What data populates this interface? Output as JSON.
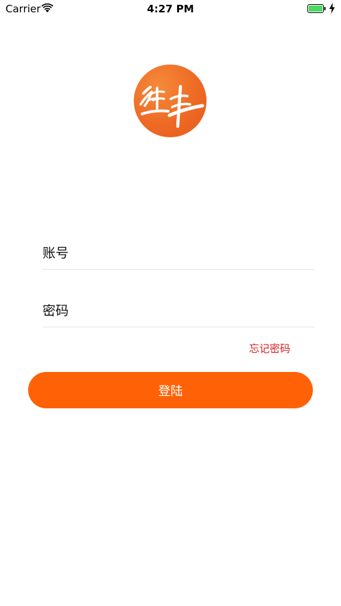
{
  "status_bar": {
    "carrier": "Carrier",
    "time": "4:27 PM"
  },
  "logo": {
    "text": "继丰",
    "color": "#ee6a24"
  },
  "form": {
    "account_label": "账号",
    "account_value": "",
    "password_label": "密码",
    "password_value": "",
    "forgot_label": "忘记密码",
    "login_label": "登陆"
  },
  "colors": {
    "accent": "#ff6106",
    "forgot_link": "#d81e1e",
    "battery": "#4cd964"
  }
}
